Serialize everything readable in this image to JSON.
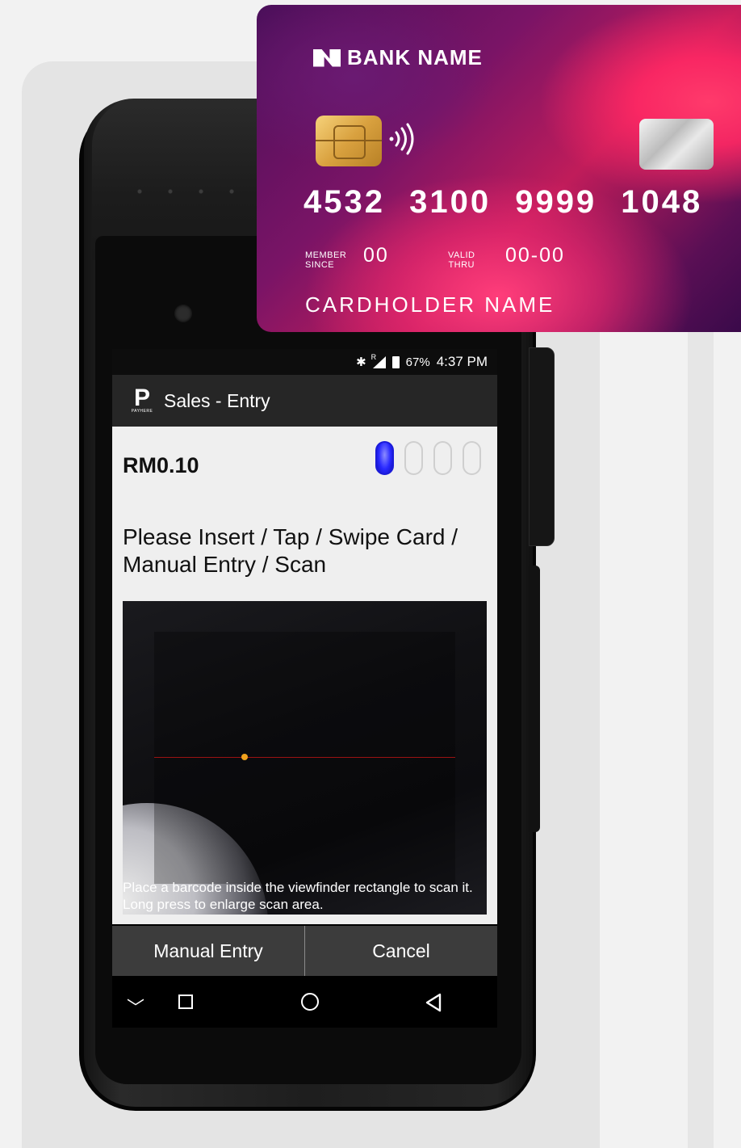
{
  "card": {
    "bank_name": "BANK NAME",
    "number": "4532 3100 9999 1048",
    "member_since_label_1": "MEMBER",
    "member_since_label_2": "SINCE",
    "member_since_value": "00",
    "valid_thru_label_1": "VALID",
    "valid_thru_label_2": "THRU",
    "valid_thru_value": "00-00",
    "cardholder": "CARDHOLDER NAME",
    "contactless_symbol": "·)))"
  },
  "status_bar": {
    "battery_percent": "67%",
    "time": "4:37 PM",
    "bluetooth_icon": "✱",
    "roaming": "R"
  },
  "app_bar": {
    "logo_letter": "P",
    "logo_text": "PAYHERE",
    "title": "Sales - Entry"
  },
  "entry": {
    "amount": "RM0.10",
    "instruction": "Please Insert / Tap / Swipe Card / Manual Entry / Scan",
    "scanner_hint": "Place a barcode inside the viewfinder rectangle to scan it. Long press to enlarge scan area.",
    "progress_steps_total": 4,
    "progress_steps_active": 1
  },
  "buttons": {
    "manual_entry": "Manual Entry",
    "cancel": "Cancel"
  },
  "nav": {
    "down_glyph": "﹀",
    "back_glyph": "◁"
  },
  "colors": {
    "step_active": "#2828ff",
    "scan_dot": "#f0a21d",
    "scan_line": "#9b1212"
  }
}
